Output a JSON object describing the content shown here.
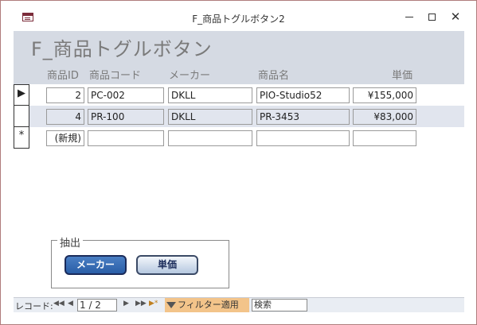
{
  "window": {
    "title": "F_商品トグルボタン2",
    "close_glyph": "✕"
  },
  "form": {
    "title": "F_商品トグルボタン",
    "columns": [
      "商品ID",
      "商品コード",
      "メーカー",
      "商品名",
      "単価"
    ]
  },
  "records": [
    {
      "selector": "▶",
      "id": "2",
      "code": "PC-002",
      "maker": "DKLL",
      "name": "PIO-Studio52",
      "price": "¥155,000"
    },
    {
      "selector": "",
      "id": "4",
      "code": "PR-100",
      "maker": "DKLL",
      "name": "PR-3453",
      "price": "¥83,000"
    },
    {
      "selector": "*",
      "id": "(新規)",
      "code": "",
      "maker": "",
      "name": "",
      "price": ""
    }
  ],
  "filter_group": {
    "label": "抽出",
    "maker_button": "メーカー",
    "price_button": "単価",
    "maker_pressed": true,
    "price_pressed": false
  },
  "navigation": {
    "label": "レコード:",
    "first": "◀◀",
    "prev": "◀",
    "position": "1 / 2",
    "next": "▶",
    "last": "▶▶",
    "new": "▶*",
    "filter_status": "フィルター適用",
    "search_placeholder": "検索"
  }
}
